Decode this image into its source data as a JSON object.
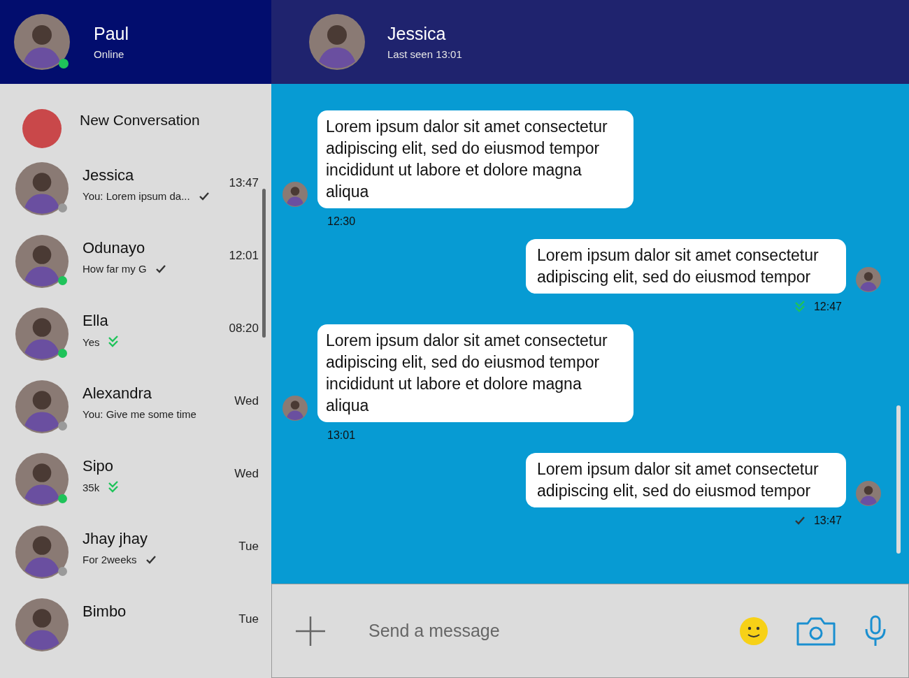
{
  "user": {
    "name": "Paul",
    "status": "Online",
    "online": true
  },
  "contact": {
    "name": "Jessica",
    "status": "Last seen 13:01"
  },
  "new_conversation": {
    "label": "New Conversation"
  },
  "conversations": [
    {
      "name": "Jessica",
      "preview": "You: Lorem ipsum da...",
      "time": "13:47",
      "online": false,
      "read": false
    },
    {
      "name": "Odunayo",
      "preview": "How far my G",
      "time": "12:01",
      "online": true,
      "read": false
    },
    {
      "name": "Ella",
      "preview": "Yes",
      "time": "08:20",
      "online": true,
      "read": true
    },
    {
      "name": "Alexandra",
      "preview": "You: Give me some time",
      "time": "Wed",
      "online": false
    },
    {
      "name": "Sipo",
      "preview": "35k",
      "time": "Wed",
      "online": true,
      "read": true
    },
    {
      "name": "Jhay jhay",
      "preview": "For 2weeks",
      "time": "Tue",
      "online": false,
      "read": false
    },
    {
      "name": "Bimbo",
      "time": "Tue"
    }
  ],
  "messages": [
    {
      "kind": "incoming",
      "text": "Lorem ipsum dalor sit amet consectetur adipiscing elit, sed do eiusmod tempor incididunt ut labore et dolore magna aliqua",
      "time": "12:30"
    },
    {
      "kind": "outgoing",
      "text": "Lorem ipsum dalor sit amet consectetur adipiscing elit, sed do eiusmod tempor",
      "time": "12:47",
      "read": true
    },
    {
      "kind": "incoming",
      "text": "Lorem ipsum dalor sit amet consectetur adipiscing elit, sed do eiusmod tempor incididunt ut labore et dolore magna aliqua",
      "time": "13:01"
    },
    {
      "kind": "outgoing",
      "text": "Lorem ipsum dalor sit amet consectetur adipiscing elit, sed do eiusmod tempor",
      "time": "13:47",
      "read": false
    }
  ],
  "composer": {
    "placeholder": "Send a message"
  }
}
